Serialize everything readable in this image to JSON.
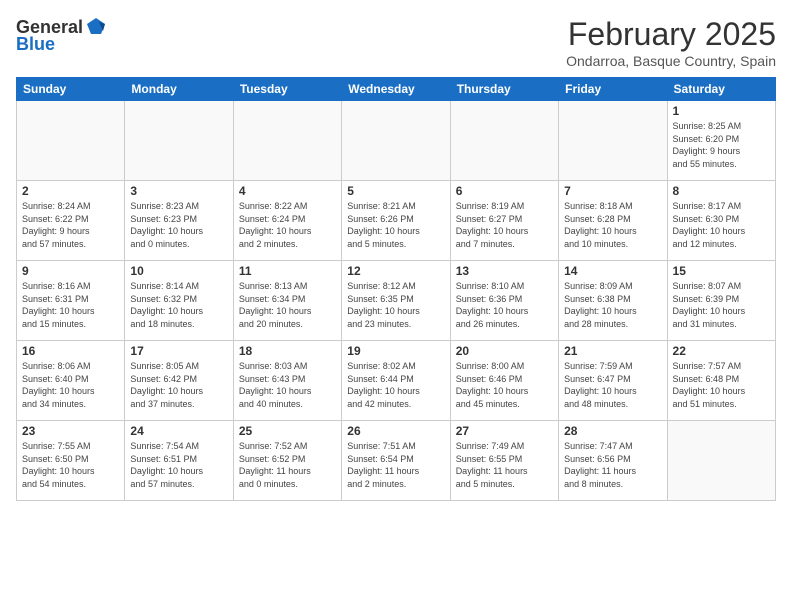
{
  "header": {
    "logo_general": "General",
    "logo_blue": "Blue",
    "month_title": "February 2025",
    "location": "Ondarroa, Basque Country, Spain"
  },
  "weekdays": [
    "Sunday",
    "Monday",
    "Tuesday",
    "Wednesday",
    "Thursday",
    "Friday",
    "Saturday"
  ],
  "weeks": [
    [
      {
        "day": "",
        "info": ""
      },
      {
        "day": "",
        "info": ""
      },
      {
        "day": "",
        "info": ""
      },
      {
        "day": "",
        "info": ""
      },
      {
        "day": "",
        "info": ""
      },
      {
        "day": "",
        "info": ""
      },
      {
        "day": "1",
        "info": "Sunrise: 8:25 AM\nSunset: 6:20 PM\nDaylight: 9 hours\nand 55 minutes."
      }
    ],
    [
      {
        "day": "2",
        "info": "Sunrise: 8:24 AM\nSunset: 6:22 PM\nDaylight: 9 hours\nand 57 minutes."
      },
      {
        "day": "3",
        "info": "Sunrise: 8:23 AM\nSunset: 6:23 PM\nDaylight: 10 hours\nand 0 minutes."
      },
      {
        "day": "4",
        "info": "Sunrise: 8:22 AM\nSunset: 6:24 PM\nDaylight: 10 hours\nand 2 minutes."
      },
      {
        "day": "5",
        "info": "Sunrise: 8:21 AM\nSunset: 6:26 PM\nDaylight: 10 hours\nand 5 minutes."
      },
      {
        "day": "6",
        "info": "Sunrise: 8:19 AM\nSunset: 6:27 PM\nDaylight: 10 hours\nand 7 minutes."
      },
      {
        "day": "7",
        "info": "Sunrise: 8:18 AM\nSunset: 6:28 PM\nDaylight: 10 hours\nand 10 minutes."
      },
      {
        "day": "8",
        "info": "Sunrise: 8:17 AM\nSunset: 6:30 PM\nDaylight: 10 hours\nand 12 minutes."
      }
    ],
    [
      {
        "day": "9",
        "info": "Sunrise: 8:16 AM\nSunset: 6:31 PM\nDaylight: 10 hours\nand 15 minutes."
      },
      {
        "day": "10",
        "info": "Sunrise: 8:14 AM\nSunset: 6:32 PM\nDaylight: 10 hours\nand 18 minutes."
      },
      {
        "day": "11",
        "info": "Sunrise: 8:13 AM\nSunset: 6:34 PM\nDaylight: 10 hours\nand 20 minutes."
      },
      {
        "day": "12",
        "info": "Sunrise: 8:12 AM\nSunset: 6:35 PM\nDaylight: 10 hours\nand 23 minutes."
      },
      {
        "day": "13",
        "info": "Sunrise: 8:10 AM\nSunset: 6:36 PM\nDaylight: 10 hours\nand 26 minutes."
      },
      {
        "day": "14",
        "info": "Sunrise: 8:09 AM\nSunset: 6:38 PM\nDaylight: 10 hours\nand 28 minutes."
      },
      {
        "day": "15",
        "info": "Sunrise: 8:07 AM\nSunset: 6:39 PM\nDaylight: 10 hours\nand 31 minutes."
      }
    ],
    [
      {
        "day": "16",
        "info": "Sunrise: 8:06 AM\nSunset: 6:40 PM\nDaylight: 10 hours\nand 34 minutes."
      },
      {
        "day": "17",
        "info": "Sunrise: 8:05 AM\nSunset: 6:42 PM\nDaylight: 10 hours\nand 37 minutes."
      },
      {
        "day": "18",
        "info": "Sunrise: 8:03 AM\nSunset: 6:43 PM\nDaylight: 10 hours\nand 40 minutes."
      },
      {
        "day": "19",
        "info": "Sunrise: 8:02 AM\nSunset: 6:44 PM\nDaylight: 10 hours\nand 42 minutes."
      },
      {
        "day": "20",
        "info": "Sunrise: 8:00 AM\nSunset: 6:46 PM\nDaylight: 10 hours\nand 45 minutes."
      },
      {
        "day": "21",
        "info": "Sunrise: 7:59 AM\nSunset: 6:47 PM\nDaylight: 10 hours\nand 48 minutes."
      },
      {
        "day": "22",
        "info": "Sunrise: 7:57 AM\nSunset: 6:48 PM\nDaylight: 10 hours\nand 51 minutes."
      }
    ],
    [
      {
        "day": "23",
        "info": "Sunrise: 7:55 AM\nSunset: 6:50 PM\nDaylight: 10 hours\nand 54 minutes."
      },
      {
        "day": "24",
        "info": "Sunrise: 7:54 AM\nSunset: 6:51 PM\nDaylight: 10 hours\nand 57 minutes."
      },
      {
        "day": "25",
        "info": "Sunrise: 7:52 AM\nSunset: 6:52 PM\nDaylight: 11 hours\nand 0 minutes."
      },
      {
        "day": "26",
        "info": "Sunrise: 7:51 AM\nSunset: 6:54 PM\nDaylight: 11 hours\nand 2 minutes."
      },
      {
        "day": "27",
        "info": "Sunrise: 7:49 AM\nSunset: 6:55 PM\nDaylight: 11 hours\nand 5 minutes."
      },
      {
        "day": "28",
        "info": "Sunrise: 7:47 AM\nSunset: 6:56 PM\nDaylight: 11 hours\nand 8 minutes."
      },
      {
        "day": "",
        "info": ""
      }
    ]
  ]
}
